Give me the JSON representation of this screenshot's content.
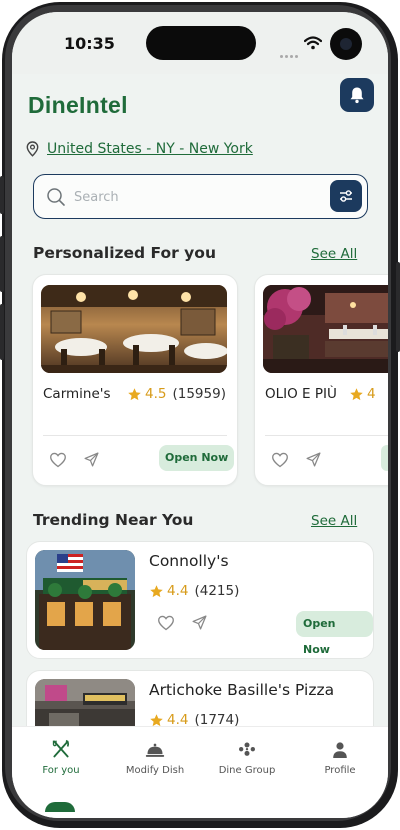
{
  "status_bar": {
    "time": "10:35"
  },
  "header": {
    "logo_text": "DineIntel",
    "bell_icon": "bell-icon"
  },
  "location": {
    "icon": "pin-icon",
    "text": "United States - NY - New York"
  },
  "search": {
    "placeholder": "Search",
    "value": "",
    "filter_icon": "sliders-icon"
  },
  "personalized": {
    "title": "Personalized For you",
    "see_all": "See All",
    "cards": [
      {
        "name": "Carmine's",
        "rating": "4.5",
        "count": "(15959)",
        "status": "Open Now"
      },
      {
        "name": "OLIO E PIÙ",
        "rating": "4",
        "count": "",
        "status": ""
      }
    ]
  },
  "trending": {
    "title": "Trending Near You",
    "see_all": "See All",
    "items": [
      {
        "name": "Connolly's",
        "rating": "4.4",
        "count": "(4215)",
        "status": "Open Now"
      },
      {
        "name": "Artichoke Basille's Pizza",
        "rating": "4.4",
        "count": "(1774)"
      }
    ]
  },
  "nav": {
    "items": [
      {
        "label": "For you",
        "icon": "fork-knife-icon",
        "active": true
      },
      {
        "label": "Modify Dish",
        "icon": "cloche-icon",
        "active": false
      },
      {
        "label": "Dine Group",
        "icon": "group-icon",
        "active": false
      },
      {
        "label": "Profile",
        "icon": "person-icon",
        "active": false
      }
    ]
  },
  "colors": {
    "brand_green": "#1f6b3a",
    "navy": "#1c3a5e",
    "star": "#d79b1a",
    "badge_bg": "#d8ecdd"
  }
}
